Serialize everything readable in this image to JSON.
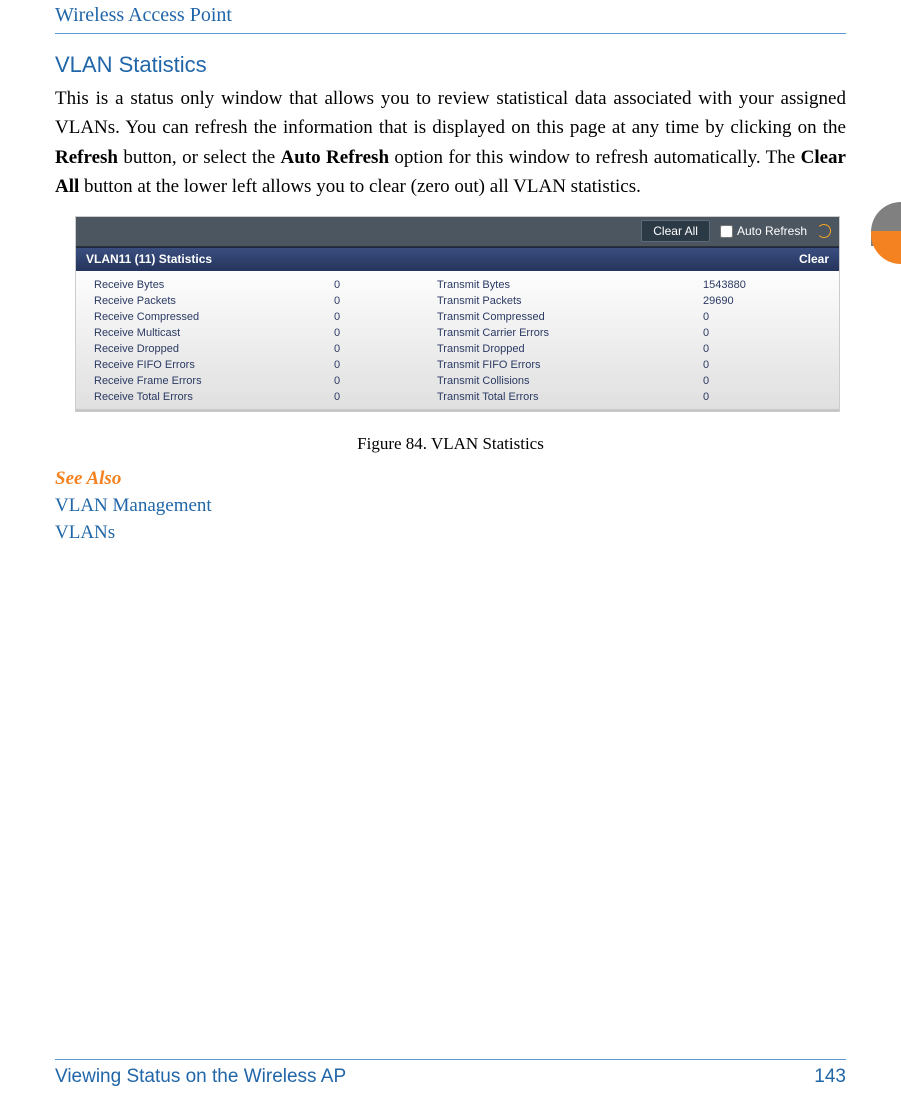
{
  "header": {
    "title": "Wireless Access Point"
  },
  "section": {
    "title": "VLAN Statistics",
    "body_parts": [
      "This is a status only window that allows you to review statistical data associated with your assigned VLANs. You can refresh the information that is displayed on this page at any time by clicking on the ",
      "Refresh",
      " button, or select the ",
      "Auto Refresh",
      " option for this window to refresh automatically. The ",
      "Clear All",
      " button at the lower left allows you to clear (zero out) all VLAN statistics."
    ]
  },
  "figure": {
    "toolbar": {
      "clear_all_label": "Clear All",
      "auto_refresh_label": "Auto Refresh"
    },
    "subheader": {
      "title": "VLAN11 (11) Statistics",
      "clear_label": "Clear"
    },
    "rows": [
      {
        "rx_label": "Receive Bytes",
        "rx_val": "0",
        "tx_label": "Transmit Bytes",
        "tx_val": "1543880"
      },
      {
        "rx_label": "Receive Packets",
        "rx_val": "0",
        "tx_label": "Transmit Packets",
        "tx_val": "29690"
      },
      {
        "rx_label": "Receive Compressed",
        "rx_val": "0",
        "tx_label": "Transmit Compressed",
        "tx_val": "0"
      },
      {
        "rx_label": "Receive Multicast",
        "rx_val": "0",
        "tx_label": "Transmit Carrier Errors",
        "tx_val": "0"
      },
      {
        "rx_label": "Receive Dropped",
        "rx_val": "0",
        "tx_label": "Transmit Dropped",
        "tx_val": "0"
      },
      {
        "rx_label": "Receive FIFO Errors",
        "rx_val": "0",
        "tx_label": "Transmit FIFO Errors",
        "tx_val": "0"
      },
      {
        "rx_label": "Receive Frame Errors",
        "rx_val": "0",
        "tx_label": "Transmit Collisions",
        "tx_val": "0"
      },
      {
        "rx_label": "Receive Total Errors",
        "rx_val": "0",
        "tx_label": "Transmit Total Errors",
        "tx_val": "0"
      }
    ],
    "caption": "Figure 84. VLAN Statistics"
  },
  "see_also": {
    "heading": "See Also",
    "links": [
      "VLAN Management",
      "VLANs"
    ]
  },
  "footer": {
    "left": "Viewing Status on the Wireless AP",
    "right": "143"
  }
}
